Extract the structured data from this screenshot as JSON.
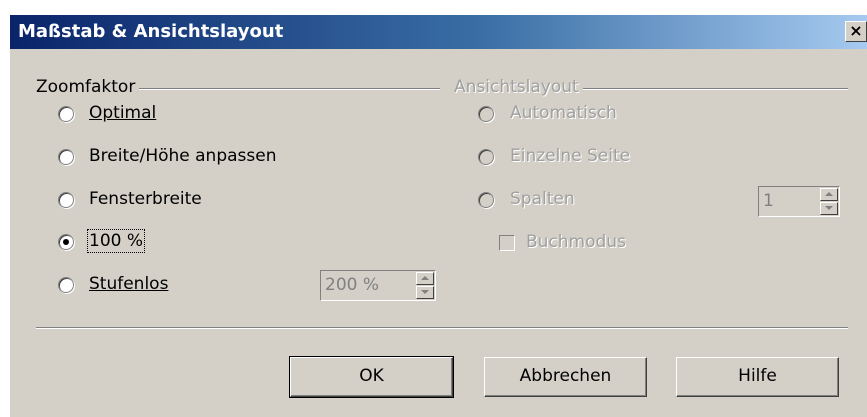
{
  "dialog": {
    "title": "Maßstab & Ansichtslayout",
    "close_glyph": "×"
  },
  "zoom": {
    "group_label": "Zoomfaktor",
    "options": [
      {
        "label": "Optimal",
        "checked": false
      },
      {
        "label": "Breite/Höhe anpassen",
        "checked": false
      },
      {
        "label": "Fensterbreite",
        "checked": false
      },
      {
        "label": "100 %",
        "checked": true
      },
      {
        "label": "Stufenlos",
        "checked": false
      }
    ],
    "stufenlos_value": "200 %"
  },
  "layout": {
    "group_label": "Ansichtslayout",
    "options": [
      {
        "label": "Automatisch",
        "checked": false
      },
      {
        "label": "Einzelne Seite",
        "checked": false
      },
      {
        "label": "Spalten",
        "checked": false
      }
    ],
    "columns_value": "1",
    "bookmode_label": "Buchmodus",
    "bookmode_checked": false
  },
  "buttons": {
    "ok": "OK",
    "cancel": "Abbrechen",
    "help": "Hilfe"
  },
  "colors": {
    "dialog_bg": "#d4d0c8",
    "title_start": "#0a246a",
    "title_end": "#a6caf0",
    "disabled_text": "#a0a0a0"
  },
  "icons": {
    "close": "close-icon",
    "spin_up": "chevron-up-icon",
    "spin_down": "chevron-down-icon"
  }
}
